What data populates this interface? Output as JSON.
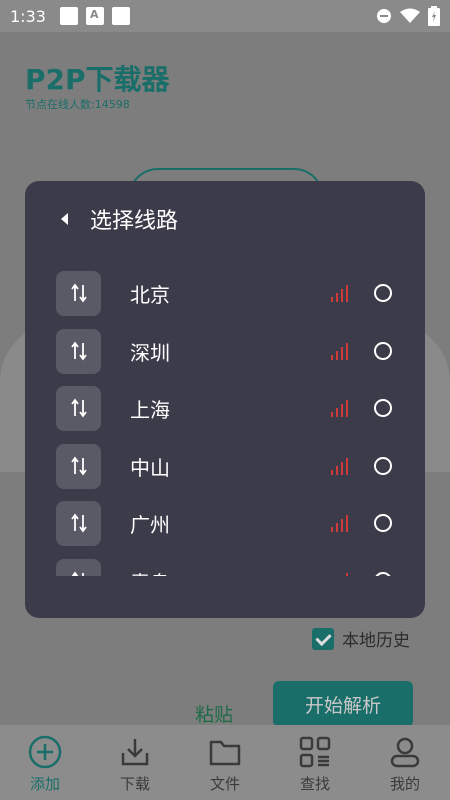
{
  "status_bar": {
    "time": "1:33"
  },
  "app": {
    "title": "P2P下载器",
    "subtitle": "节点在线人数:14598",
    "history_checkbox_label": "本地历史",
    "paste_label": "粘贴",
    "parse_button_label": "开始解析"
  },
  "modal": {
    "title": "选择线路",
    "routes": [
      {
        "name": "北京"
      },
      {
        "name": "深圳"
      },
      {
        "name": "上海"
      },
      {
        "name": "中山"
      },
      {
        "name": "广州"
      },
      {
        "name": "青岛"
      }
    ]
  },
  "nav": {
    "items": [
      {
        "label": "添加",
        "icon": "add-circle-icon"
      },
      {
        "label": "下载",
        "icon": "download-icon"
      },
      {
        "label": "文件",
        "icon": "folder-icon"
      },
      {
        "label": "查找",
        "icon": "grid-search-icon"
      },
      {
        "label": "我的",
        "icon": "person-icon"
      }
    ]
  },
  "colors": {
    "accent": "#1a6e69",
    "modal_bg": "#3c3b4a",
    "signal": "#d23a3a"
  }
}
